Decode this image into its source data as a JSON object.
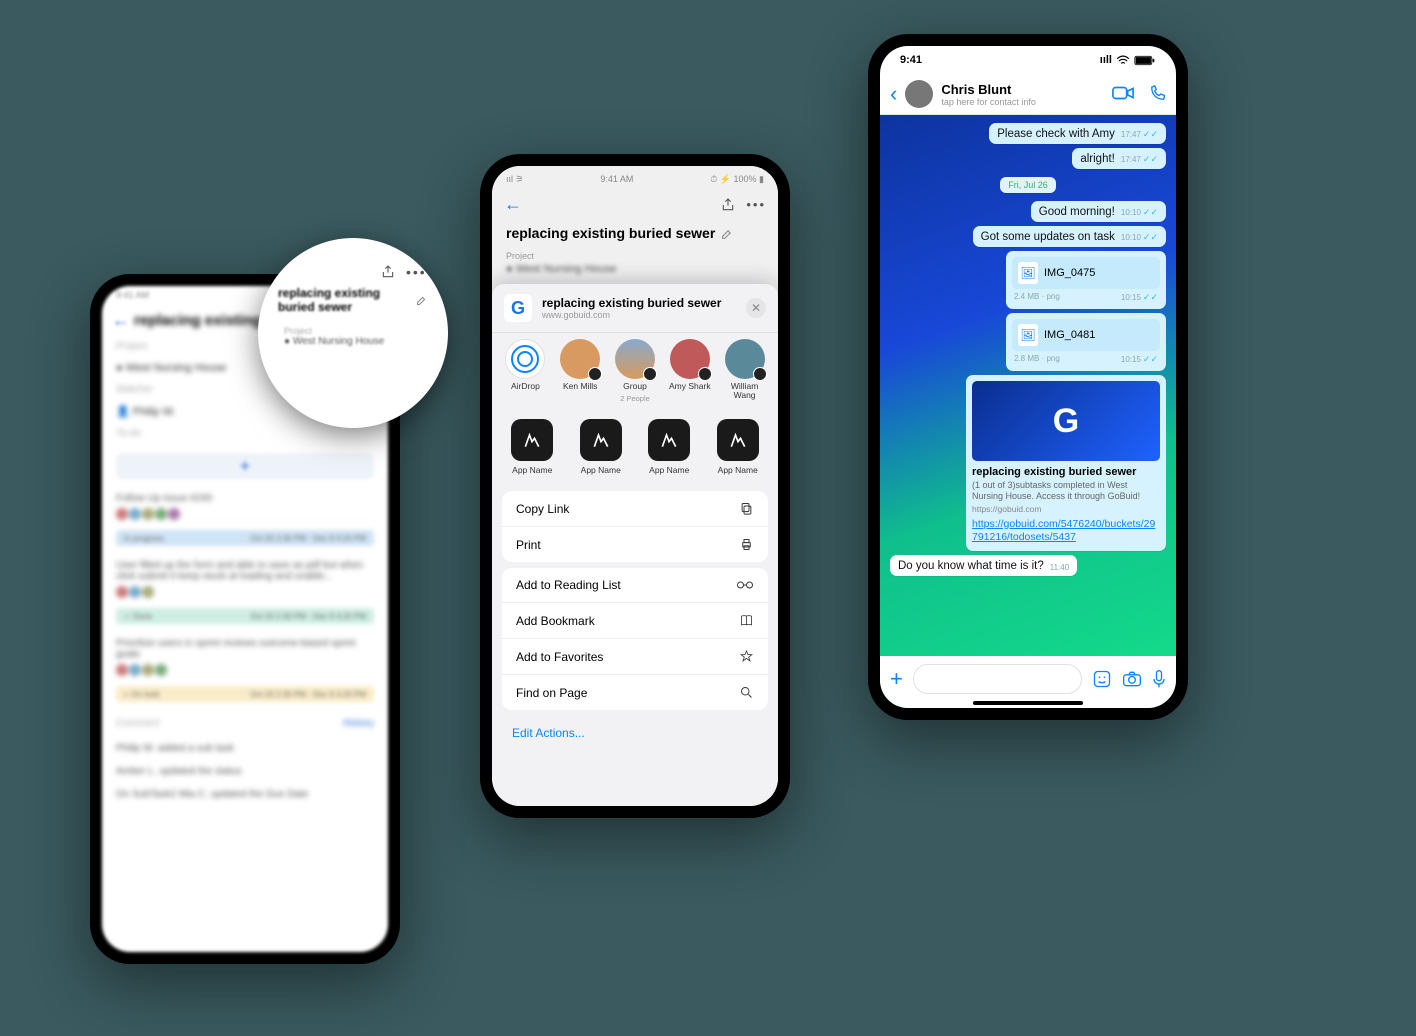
{
  "status": {
    "time": "9:41 AM",
    "battery": "100%",
    "signal": "ᯤ ⋮ ⋮",
    "short_time": "9:41"
  },
  "phone1": {
    "title": "replacing existing buried sewer",
    "project_label": "Project",
    "project_value": "West Nursing House",
    "watcher_label": "Watcher",
    "watcher_value": "Philip W.",
    "todo_label": "To-do",
    "items": [
      {
        "title": "Follow Up Issue #240",
        "status": "In progress",
        "dates": "Oct 20 2:30 PM - Dec 9 4:20 PM"
      },
      {
        "title": "User filled up the form and able to save as pdf but when click submit it keep stuck at loading and unable...",
        "status": "Done",
        "dates": "Oct 20 2:30 PM - Dec 9 4:20 PM"
      },
      {
        "title": "Prioritize users in sprint reviews outcome-based sprint goals",
        "status": "On hold",
        "dates": "Oct 20 2:30 PM - Dec 9 4:20 PM"
      }
    ],
    "comment_label": "Comment",
    "history_link": "History",
    "comments": [
      "Philip W. added a sub task",
      "Amber L. updated the status",
      "On SubTask2 Mia C. updated the Due Date"
    ]
  },
  "phone2": {
    "title": "replacing existing buried sewer",
    "project_label": "Project",
    "project_value": "West Nursing House",
    "sheet": {
      "title": "replacing existing buried sewer",
      "url": "www.gobuid.com",
      "targets": [
        {
          "name": "AirDrop",
          "sub": ""
        },
        {
          "name": "Ken Mills",
          "sub": ""
        },
        {
          "name": "Group",
          "sub": "2 People"
        },
        {
          "name": "Amy Shark",
          "sub": ""
        },
        {
          "name": "William Wang",
          "sub": ""
        }
      ],
      "apps": [
        {
          "name": "App Name"
        },
        {
          "name": "App Name"
        },
        {
          "name": "App Name"
        },
        {
          "name": "App Name"
        }
      ],
      "group1": [
        {
          "label": "Copy Link",
          "icon": "copy"
        },
        {
          "label": "Print",
          "icon": "print"
        }
      ],
      "group2": [
        {
          "label": "Add to Reading List",
          "icon": "glasses"
        },
        {
          "label": "Add Bookmark",
          "icon": "book"
        },
        {
          "label": "Add to Favorites",
          "icon": "star"
        },
        {
          "label": "Find on Page",
          "icon": "search"
        }
      ],
      "edit": "Edit Actions..."
    }
  },
  "phone3": {
    "contact": "Chris Blunt",
    "subtitle": "tap here for contact info",
    "messages": [
      {
        "kind": "out",
        "text": "Please check with Amy",
        "time": "17:47"
      },
      {
        "kind": "out",
        "text": "alright!",
        "time": "17:47"
      },
      {
        "kind": "date",
        "text": "Fri, Jul 26"
      },
      {
        "kind": "out",
        "text": "Good morning!",
        "time": "10:10"
      },
      {
        "kind": "out",
        "text": "Got some updates on task",
        "time": "10:10"
      },
      {
        "kind": "file",
        "name": "IMG_0475",
        "size": "2.4 MB",
        "ext": "png",
        "time": "10:15"
      },
      {
        "kind": "file",
        "name": "IMG_0481",
        "size": "2.8 MB",
        "ext": "png",
        "time": "10:15"
      },
      {
        "kind": "link",
        "title": "replacing existing buried sewer",
        "desc": "(1 out of 3)subtasks completed in West Nursing House. Access it through GoBuid!",
        "src": "https://gobuid.com",
        "url": "https://gobuid.com/5476240/buckets/29791216/todosets/5437"
      },
      {
        "kind": "in",
        "text": "Do you know what time is it?",
        "time": "11:40"
      }
    ]
  }
}
